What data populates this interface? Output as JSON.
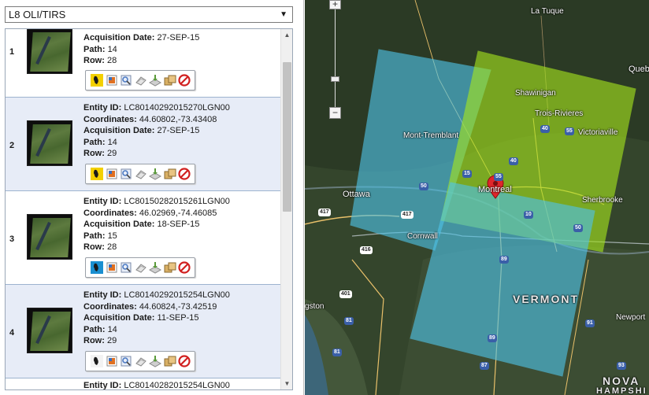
{
  "dataset": {
    "selected": "L8 OLI/TIRS"
  },
  "results": [
    {
      "num": "1",
      "entity_label": "Entity ID:",
      "entity_id": "",
      "coord_label": "Coordinates:",
      "coordinates": "",
      "date_label": "Acquisition Date:",
      "date": "27-SEP-15",
      "path_label": "Path:",
      "path": "14",
      "row_label": "Row:",
      "row": "28"
    },
    {
      "num": "2",
      "entity_label": "Entity ID:",
      "entity_id": "LC80140292015270LGN00",
      "coord_label": "Coordinates:",
      "coordinates": "44.60802,-73.43408",
      "date_label": "Acquisition Date:",
      "date": "27-SEP-15",
      "path_label": "Path:",
      "path": "14",
      "row_label": "Row:",
      "row": "29"
    },
    {
      "num": "3",
      "entity_label": "Entity ID:",
      "entity_id": "LC80150282015261LGN00",
      "coord_label": "Coordinates:",
      "coordinates": "46.02969,-74.46085",
      "date_label": "Acquisition Date:",
      "date": "18-SEP-15",
      "path_label": "Path:",
      "path": "15",
      "row_label": "Row:",
      "row": "28"
    },
    {
      "num": "4",
      "entity_label": "Entity ID:",
      "entity_id": "LC80140292015254LGN00",
      "coord_label": "Coordinates:",
      "coordinates": "44.60824,-73.42519",
      "date_label": "Acquisition Date:",
      "date": "11-SEP-15",
      "path_label": "Path:",
      "path": "14",
      "row_label": "Row:",
      "row": "29"
    },
    {
      "num": "",
      "entity_label": "Entity ID:",
      "entity_id": "LC80140282015254LGN00"
    }
  ],
  "toolbar_icons": [
    "footprint-icon",
    "overlay-icon",
    "compare-icon",
    "metadata-icon",
    "download-icon",
    "order-icon",
    "exclude-icon"
  ],
  "map": {
    "labels": {
      "la_tuque": "La Tuque",
      "quebec": "Quebe",
      "shawinigan": "Shawinigan",
      "trois_rivieres": "Trois-Rivieres",
      "victoriaville": "Victoriaville",
      "mont_tremblant": "Mont-Tremblant",
      "ottawa": "Ottawa",
      "montreal": "Montreal",
      "sherbrooke": "Sherbrooke",
      "cornwall": "Cornwall",
      "vermont": "VERMONT",
      "kingston": "gston",
      "newport": "Newport",
      "nova": "NOVA",
      "hamps": "HAMPSHI"
    },
    "shields": [
      "417",
      "417",
      "416",
      "401",
      "81",
      "81",
      "87",
      "89",
      "91",
      "93",
      "50",
      "55",
      "40",
      "15",
      "10",
      "40",
      "55",
      "50",
      "89"
    ],
    "colors": {
      "blue_scene": "#4fc3e8",
      "green_scene": "#a6e61e",
      "marker": "#e0262b"
    }
  },
  "zoom": {
    "in": "+",
    "out": "−"
  },
  "scroll": {
    "up": "▲",
    "down": "▼"
  }
}
